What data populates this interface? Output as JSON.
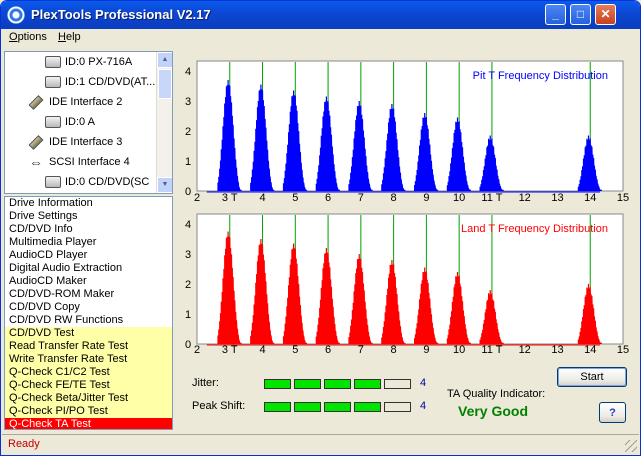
{
  "window": {
    "title": "PlexTools Professional V2.17",
    "buttons": {
      "minimize": "_",
      "maximize": "□",
      "close": "✕"
    }
  },
  "menu": {
    "items": [
      {
        "label": "Options",
        "accel": "O"
      },
      {
        "label": "Help",
        "accel": "H"
      }
    ]
  },
  "tree": {
    "rows": [
      {
        "label": "ID:0  PX-716A",
        "icon": "drive-icon",
        "indent": 2
      },
      {
        "label": "ID:1  CD/DVD(AT...",
        "icon": "drive-icon",
        "indent": 2
      },
      {
        "label": "IDE Interface 2",
        "icon": "ide-icon",
        "indent": 1
      },
      {
        "label": "ID:0  A",
        "icon": "drive-icon",
        "indent": 2
      },
      {
        "label": "IDE Interface 3",
        "icon": "ide-icon",
        "indent": 1
      },
      {
        "label": "SCSI Interface 4",
        "icon": "scsi-icon",
        "indent": 1
      },
      {
        "label": "ID:0  CD/DVD(SC",
        "icon": "drive-icon",
        "indent": 2
      }
    ]
  },
  "functions": {
    "items": [
      {
        "label": "Drive Information",
        "kind": "normal"
      },
      {
        "label": "Drive Settings",
        "kind": "normal"
      },
      {
        "label": "CD/DVD Info",
        "kind": "normal"
      },
      {
        "label": "Multimedia Player",
        "kind": "normal"
      },
      {
        "label": "AudioCD Player",
        "kind": "normal"
      },
      {
        "label": "Digital Audio Extraction",
        "kind": "normal"
      },
      {
        "label": "AudioCD Maker",
        "kind": "normal"
      },
      {
        "label": "CD/DVD-ROM Maker",
        "kind": "normal"
      },
      {
        "label": "CD/DVD Copy",
        "kind": "normal"
      },
      {
        "label": "CD/DVD RW Functions",
        "kind": "normal"
      },
      {
        "label": "CD/DVD Test",
        "kind": "test"
      },
      {
        "label": "Read Transfer Rate Test",
        "kind": "test"
      },
      {
        "label": "Write Transfer Rate Test",
        "kind": "test"
      },
      {
        "label": "Q-Check C1/C2 Test",
        "kind": "test"
      },
      {
        "label": "Q-Check FE/TE Test",
        "kind": "test"
      },
      {
        "label": "Q-Check Beta/Jitter Test",
        "kind": "test"
      },
      {
        "label": "Q-Check PI/PO Test",
        "kind": "test"
      },
      {
        "label": "Q-Check TA Test",
        "kind": "selected"
      }
    ]
  },
  "chart_data": [
    {
      "type": "area",
      "title": "Pit T Frequency Distribution",
      "color": "#0000FF",
      "xlim": [
        2,
        15
      ],
      "ylim": [
        0,
        4
      ],
      "yticks": [
        "0",
        "1",
        "2",
        "3",
        "4"
      ],
      "xticks": [
        "2",
        "3 T",
        "4",
        "5",
        "6",
        "7",
        "8",
        "9",
        "10",
        "11 T",
        "12",
        "13",
        "14",
        "15"
      ],
      "peaks": [
        {
          "center": 3.0,
          "height": 3.7
        },
        {
          "center": 4.0,
          "height": 3.55
        },
        {
          "center": 5.0,
          "height": 3.35
        },
        {
          "center": 6.0,
          "height": 3.15
        },
        {
          "center": 7.0,
          "height": 3.0
        },
        {
          "center": 8.0,
          "height": 2.9
        },
        {
          "center": 9.0,
          "height": 2.6
        },
        {
          "center": 10.0,
          "height": 2.45
        },
        {
          "center": 11.0,
          "height": 1.85
        },
        {
          "center": 14.0,
          "height": 1.85
        }
      ],
      "markers": [
        3,
        4,
        5,
        6,
        7,
        8,
        9,
        10,
        11,
        14
      ]
    },
    {
      "type": "area",
      "title": "Land T Frequency Distribution",
      "color": "#FF0000",
      "xlim": [
        2,
        15
      ],
      "ylim": [
        0,
        4
      ],
      "yticks": [
        "0",
        "1",
        "2",
        "3",
        "4"
      ],
      "xticks": [
        "2",
        "3 T",
        "4",
        "5",
        "6",
        "7",
        "8",
        "9",
        "10",
        "11 T",
        "12",
        "13",
        "14",
        "15"
      ],
      "peaks": [
        {
          "center": 3.0,
          "height": 3.75
        },
        {
          "center": 4.0,
          "height": 3.5
        },
        {
          "center": 5.0,
          "height": 3.35
        },
        {
          "center": 6.0,
          "height": 3.2
        },
        {
          "center": 7.0,
          "height": 3.0
        },
        {
          "center": 8.0,
          "height": 2.8
        },
        {
          "center": 9.0,
          "height": 2.55
        },
        {
          "center": 10.0,
          "height": 2.4
        },
        {
          "center": 11.0,
          "height": 1.8
        },
        {
          "center": 14.0,
          "height": 2.0
        }
      ],
      "markers": [
        3,
        4,
        5,
        6,
        7,
        8,
        9,
        10,
        11,
        14
      ]
    }
  ],
  "results": {
    "jitter_label": "Jitter:",
    "jitter_value": "4",
    "jitter_level": 4,
    "peak_shift_label": "Peak Shift:",
    "peak_shift_value": "4",
    "peak_shift_level": 4,
    "meter_max": 5,
    "ta_label": "TA Quality Indicator:",
    "ta_value": "Very Good",
    "start_label": "Start",
    "help_label": "?"
  },
  "status": {
    "text": "Ready"
  },
  "colors": {
    "meter_on": "#00E400",
    "status_text": "#C00000",
    "ta_value": "#008000",
    "marker": "#00A000"
  }
}
